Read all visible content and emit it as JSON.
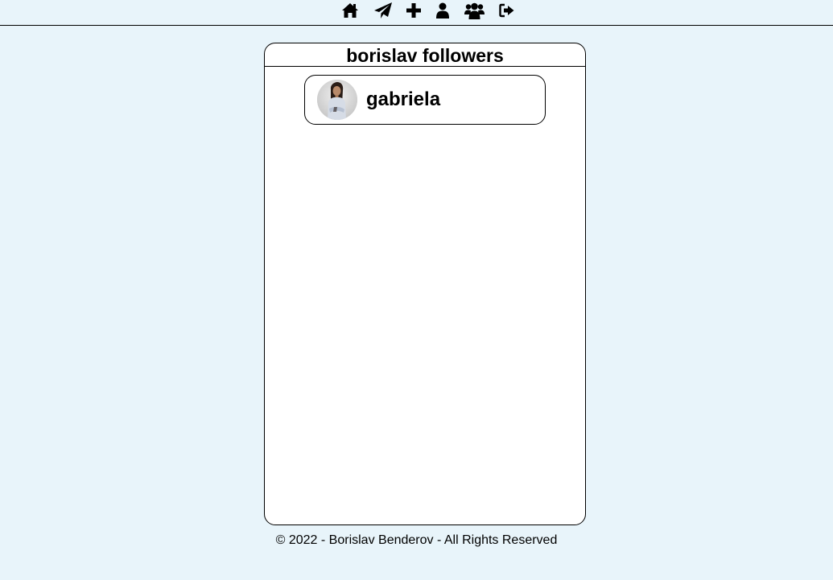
{
  "nav": {
    "icons": [
      "home-icon",
      "paper-plane-icon",
      "plus-icon",
      "user-icon",
      "users-icon",
      "sign-out-icon"
    ]
  },
  "card": {
    "title": "borislav followers"
  },
  "followers": [
    {
      "name": "gabriela",
      "avatar": "avatar"
    }
  ],
  "footer": {
    "text": "© 2022 - Borislav Benderov - All Rights Reserved"
  }
}
